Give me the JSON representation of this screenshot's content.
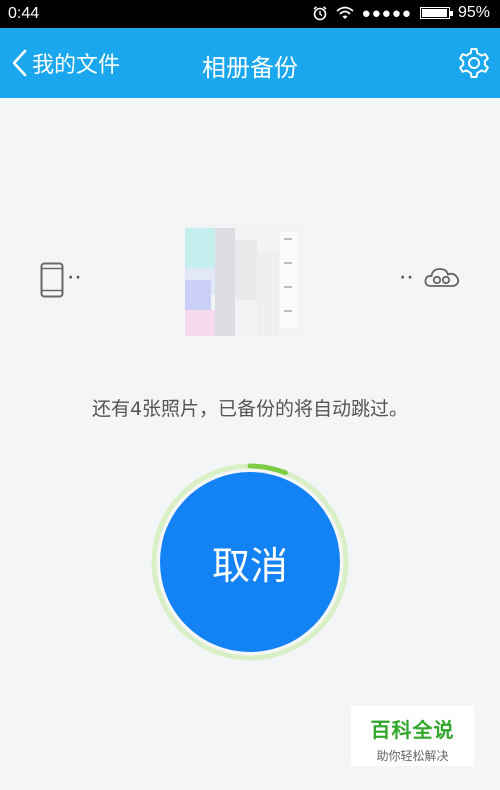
{
  "status_bar": {
    "time": "0:44",
    "signal": "●●●●●",
    "battery_percent": "95%",
    "battery_level": 0.95
  },
  "nav": {
    "back_label": "我的文件",
    "title": "相册备份"
  },
  "transfer": {
    "dots": "··"
  },
  "message": "还有4张照片，已备份的将自动跳过。",
  "progress": {
    "value": 0.06,
    "track_color": "#d9f0c6",
    "fill_color": "#7ccc44"
  },
  "cancel_label": "取消",
  "watermark": {
    "title": "百科全说",
    "subtitle": "助你轻松解决"
  },
  "colors": {
    "nav_bg": "#1aa7ed",
    "button": "#1282f5"
  }
}
